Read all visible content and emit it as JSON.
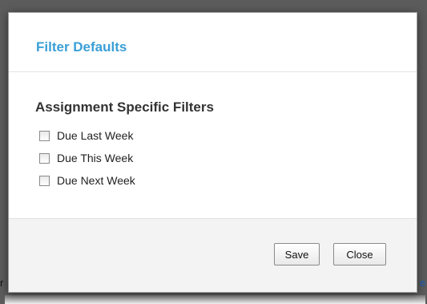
{
  "dialog": {
    "title": "Filter Defaults",
    "section_title": "Assignment Specific Filters",
    "options": [
      {
        "label": "Due Last Week",
        "checked": false
      },
      {
        "label": "Due This Week",
        "checked": false
      },
      {
        "label": "Due Next Week",
        "checked": false
      }
    ],
    "save_label": "Save",
    "close_label": "Close"
  },
  "background": {
    "left_peek_text": "r",
    "right_peek_text": "e"
  },
  "colors": {
    "title": "#3a9fd6",
    "footer_bg": "#f3f3f3",
    "backdrop": "#5c5c5c"
  }
}
